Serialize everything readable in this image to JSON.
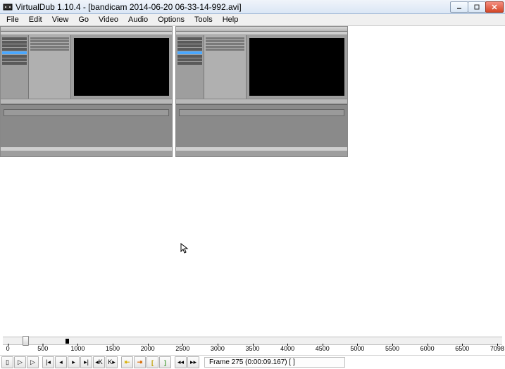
{
  "window": {
    "title": "VirtualDub 1.10.4 - [bandicam 2014-06-20 06-33-14-992.avi]"
  },
  "menu": {
    "items": [
      "File",
      "Edit",
      "View",
      "Go",
      "Video",
      "Audio",
      "Options",
      "Tools",
      "Help"
    ]
  },
  "ruler": {
    "ticks": [
      {
        "label": "0",
        "pos": 1.0
      },
      {
        "label": "500",
        "pos": 8.0
      },
      {
        "label": "1000",
        "pos": 15.0
      },
      {
        "label": "1500",
        "pos": 22.0
      },
      {
        "label": "2000",
        "pos": 29.0
      },
      {
        "label": "2500",
        "pos": 36.0
      },
      {
        "label": "3000",
        "pos": 43.0
      },
      {
        "label": "3500",
        "pos": 50.0
      },
      {
        "label": "4000",
        "pos": 57.0
      },
      {
        "label": "4500",
        "pos": 64.0
      },
      {
        "label": "5000",
        "pos": 71.0
      },
      {
        "label": "5500",
        "pos": 78.0
      },
      {
        "label": "6000",
        "pos": 85.0
      },
      {
        "label": "6500",
        "pos": 92.0
      },
      {
        "label": "7098",
        "pos": 99.0
      }
    ]
  },
  "playback": {
    "handle_pos_percent": 3.9,
    "marker_pos_percent": 12.5
  },
  "toolbar": {
    "buttons": [
      {
        "name": "stop-button",
        "glyph": "▯"
      },
      {
        "name": "play-input-button",
        "glyph": "▷"
      },
      {
        "name": "play-output-button",
        "glyph": "▷"
      },
      {
        "name": "go-start-button",
        "glyph": "|◂"
      },
      {
        "name": "prev-frame-button",
        "glyph": "◂"
      },
      {
        "name": "next-frame-button",
        "glyph": "▸"
      },
      {
        "name": "go-end-button",
        "glyph": "▸|"
      },
      {
        "name": "prev-keyframe-button",
        "glyph": "◂K"
      },
      {
        "name": "next-keyframe-button",
        "glyph": "K▸"
      },
      {
        "name": "prev-drop-button",
        "glyph": "⇤"
      },
      {
        "name": "next-drop-button",
        "glyph": "⇥"
      },
      {
        "name": "mark-in-button",
        "glyph": "["
      },
      {
        "name": "mark-out-button",
        "glyph": "]"
      },
      {
        "name": "scene-prev-button",
        "glyph": "◂◂"
      },
      {
        "name": "scene-next-button",
        "glyph": "▸▸"
      }
    ],
    "color_indices": [
      9,
      10,
      11,
      12
    ]
  },
  "status": {
    "frame_info": "Frame 275 (0:00:09.167) [ ]"
  }
}
